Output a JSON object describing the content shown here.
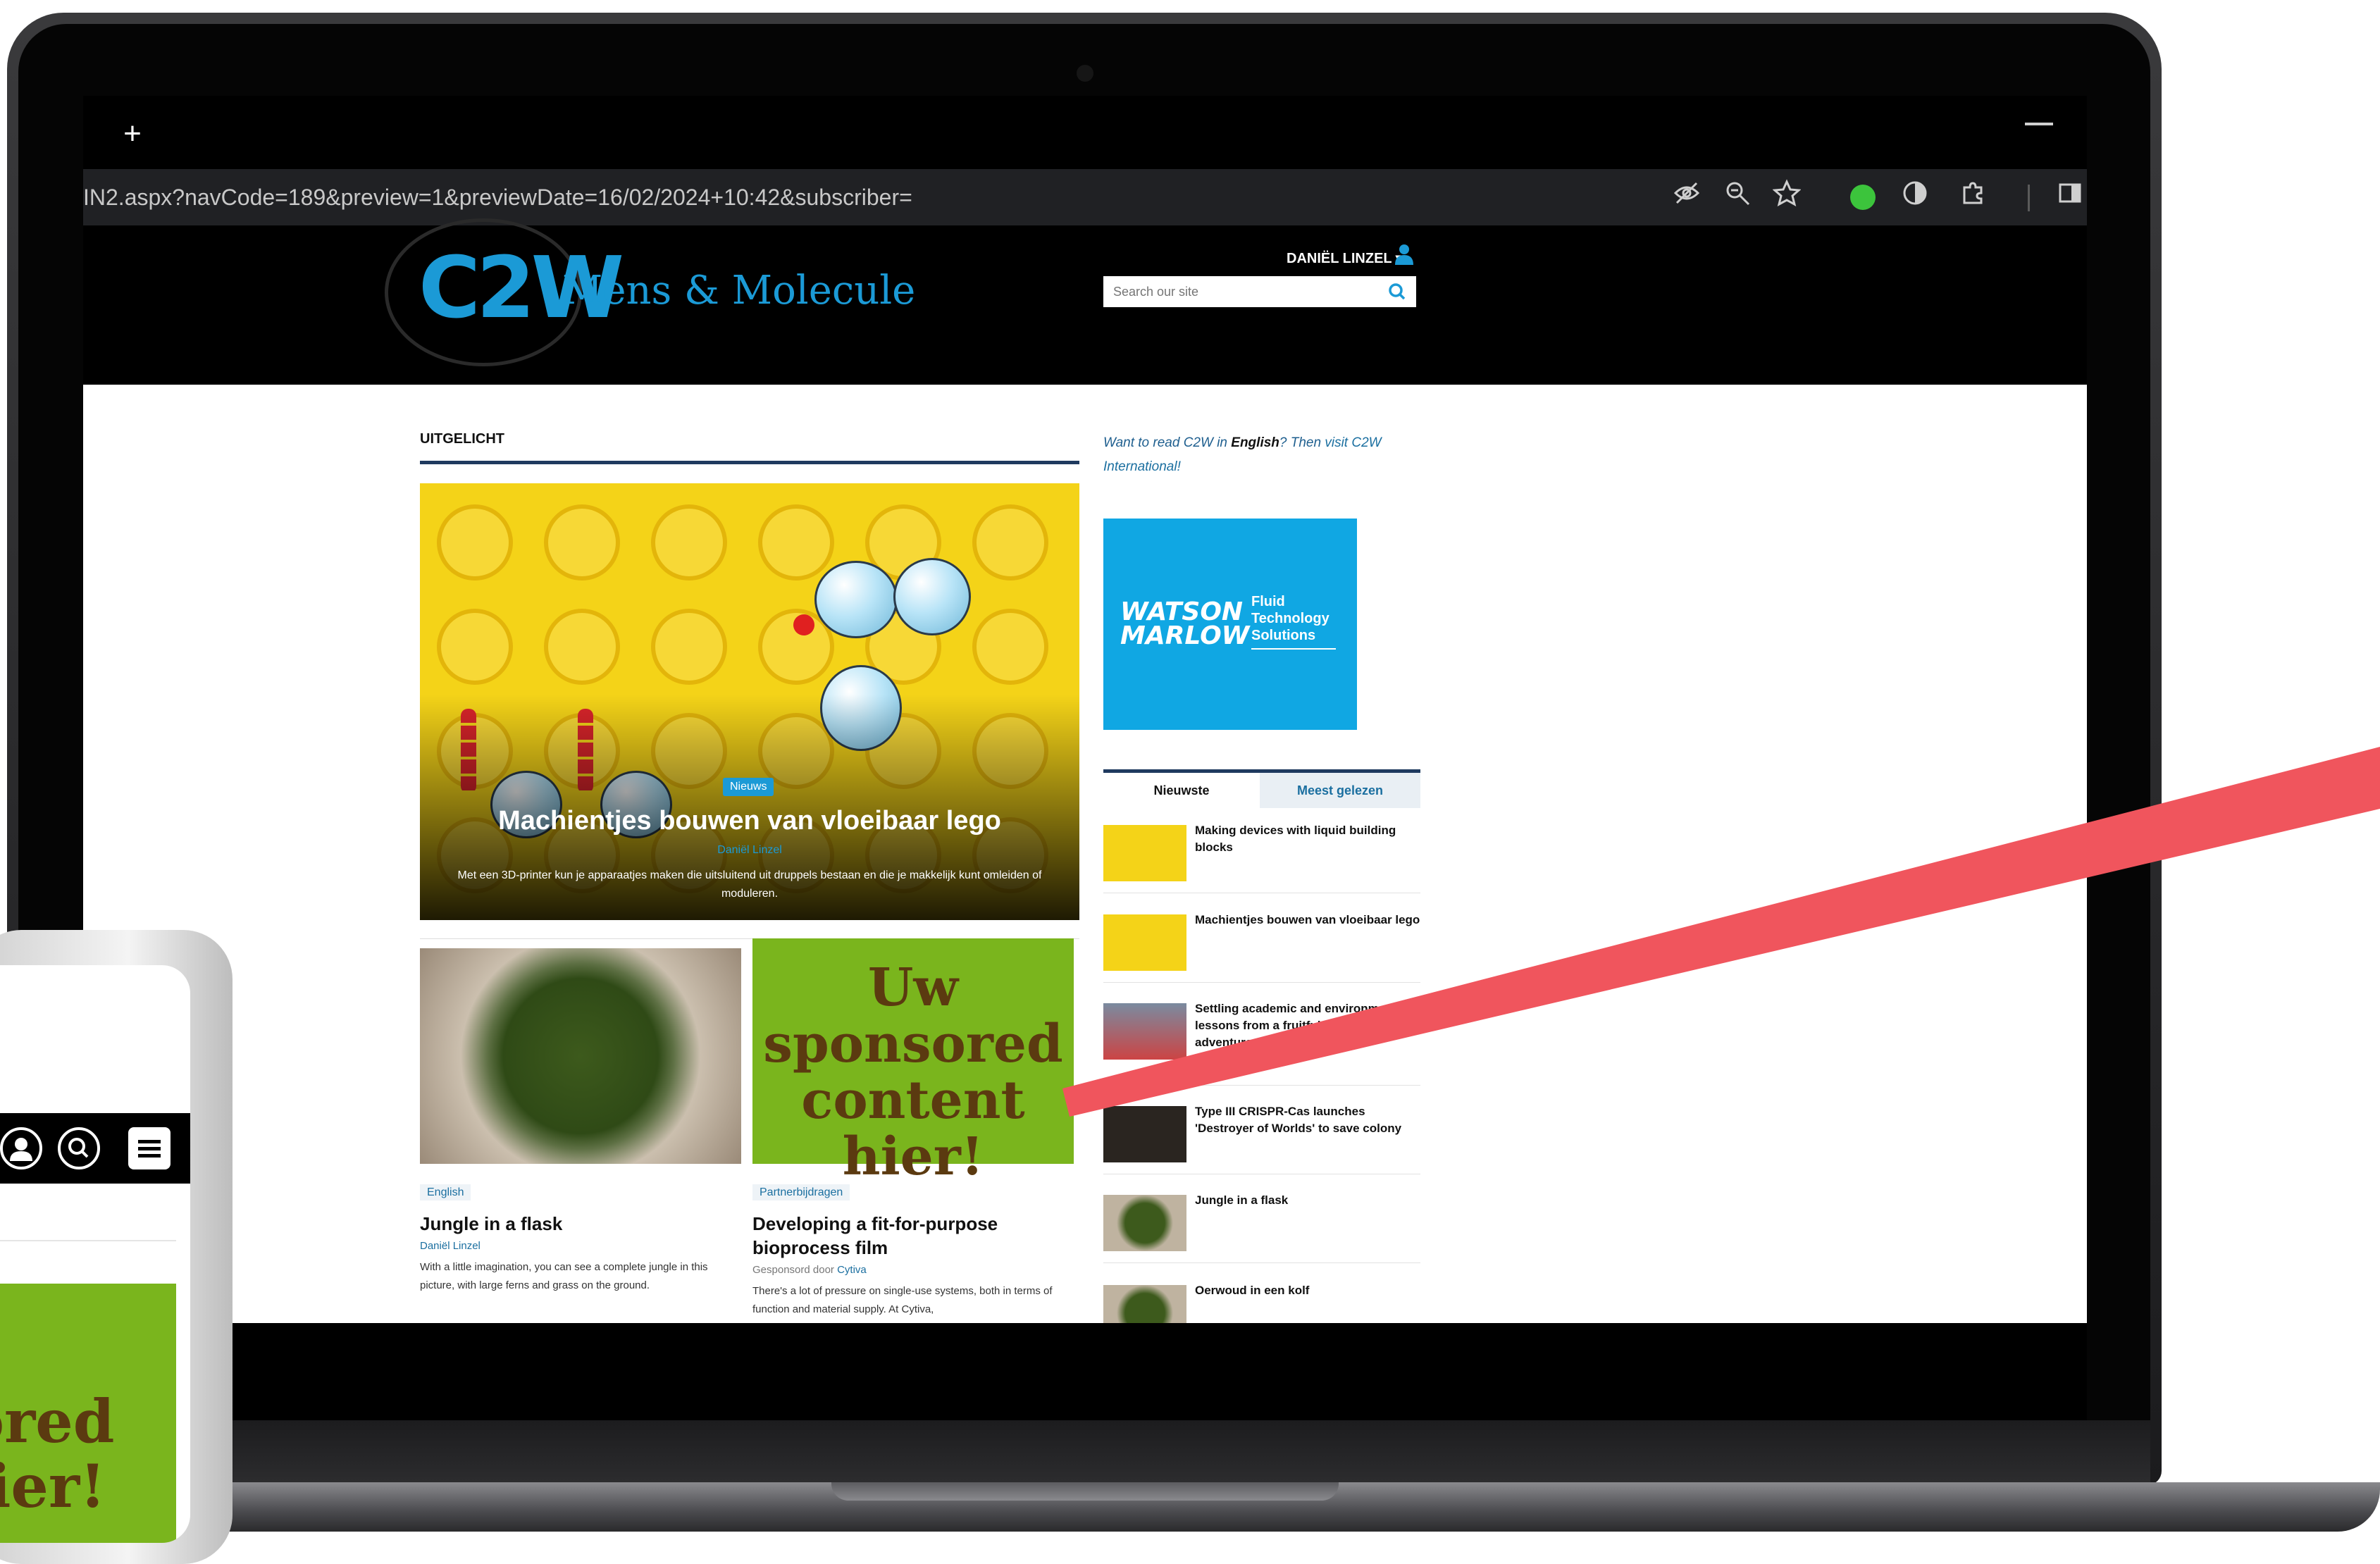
{
  "browser": {
    "new_tab": "+",
    "url": "IN2.aspx?navCode=189&preview=1&previewDate=16/02/2024+10:42&subscriber=",
    "toolbar_icons": [
      "eye-off-icon",
      "zoom-icon",
      "star-icon",
      "extension-green-icon",
      "extension-circle-icon",
      "puzzle-icon",
      "sidepanel-icon"
    ]
  },
  "site": {
    "logo": "C2W",
    "logo_subtitle": "Mens & Molecule",
    "user": "DANIËL LINZEL",
    "search_placeholder": "Search our site",
    "accent": "#1b9ad6"
  },
  "main": {
    "section_title": "UITGELICHT",
    "hero": {
      "badge": "Nieuws",
      "title": "Machientjes bouwen van vloeibaar lego",
      "author": "Daniël Linzel",
      "description": "Met een 3D-printer kun je apparaatjes maken die uitsluitend uit druppels bestaan en die je makkelijk kunt omleiden of moduleren."
    },
    "cards": [
      {
        "tag": "English",
        "title": "Jungle in a flask",
        "author": "Daniël Linzel",
        "description": "With a little imagination, you can see a complete jungle in this picture, with large ferns and grass on the ground."
      },
      {
        "tag": "Partnerbijdragen",
        "image_text": "Uw sponsored content hier!",
        "title": "Developing a fit-for-purpose bioprocess film",
        "author_prefix": "Gesponsord door",
        "author": "Cytiva",
        "description": "There's a lot of pressure on single-use systems, both in terms of function and material supply. At Cytiva,"
      }
    ]
  },
  "sidebar": {
    "promo_text_1": "Want to read C2W in ",
    "promo_bold": "English",
    "promo_text_2": "? Then ",
    "promo_link": "visit C2W International!",
    "ad": {
      "brand_line1": "WATSON",
      "brand_line2": "MARLOW",
      "tagline_1": "Fluid",
      "tagline_2": "Technology",
      "tagline_3": "Solutions"
    },
    "tabs": [
      "Nieuwste",
      "Meest gelezen"
    ],
    "news": [
      "Making devices with liquid building blocks",
      "Machientjes bouwen van vloeibaar lego",
      "Settling academic and environment: lessons from a fruitful decade of Dutch adventure",
      "Type III CRISPR-Cas launches 'Destroyer of Worlds' to save colony",
      "Jungle in a flask",
      "Oerwoud in een kolf"
    ]
  },
  "phone": {
    "ad_text_1": "ored",
    "ad_text_2": "ier!"
  },
  "colors": {
    "arrow": "#f0555d",
    "sponsor_green": "#7ab51d",
    "hero_yellow": "#f4d318",
    "ad_blue": "#10a7e3"
  }
}
